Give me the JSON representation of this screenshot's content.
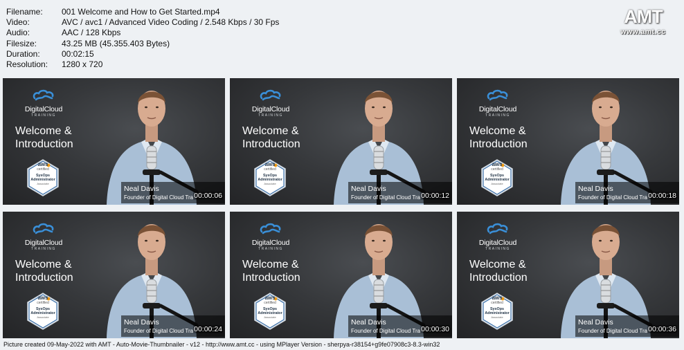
{
  "meta": [
    {
      "key": "Filename:",
      "value": "001 Welcome and How to Get Started.mp4"
    },
    {
      "key": "Video:",
      "value": "AVC / avc1 / Advanced Video Coding / 2.548 Kbps / 30 Fps"
    },
    {
      "key": "Audio:",
      "value": "AAC / 128 Kbps"
    },
    {
      "key": "Filesize:",
      "value": "43.25 MB (45.355.403 Bytes)"
    },
    {
      "key": "Duration:",
      "value": "00:02:15"
    },
    {
      "key": "Resolution:",
      "value": "1280 x 720"
    }
  ],
  "watermark": {
    "mark": "AMT",
    "url": "www.amt.cc"
  },
  "slide": {
    "brand": "DigitalCloud",
    "brand_sub": "TRAINING",
    "title_line1": "Welcome &",
    "title_line2": "Introduction",
    "badge_aws": "aws",
    "badge_cert": "certified",
    "badge_role1": "SysOps",
    "badge_role2": "Administrator",
    "badge_assoc": "Associate",
    "presenter": "Neal Davis",
    "presenter_role": "Founder of Digital Cloud Tra"
  },
  "thumbnails": [
    {
      "time": "00:00:06"
    },
    {
      "time": "00:00:12"
    },
    {
      "time": "00:00:18"
    },
    {
      "time": "00:00:24"
    },
    {
      "time": "00:00:30"
    },
    {
      "time": "00:00:36"
    }
  ],
  "footer": "Picture created 09-May-2022 with AMT - Auto-Movie-Thumbnailer - v12 - http://www.amt.cc - using MPlayer Version - sherpya-r38154+g9fe07908c3-8.3-win32",
  "colors": {
    "background": "#eef1f4",
    "slide_bg": "#36383b",
    "shirt": "#a9bfd6",
    "brand_blue": "#3a8fd8"
  }
}
